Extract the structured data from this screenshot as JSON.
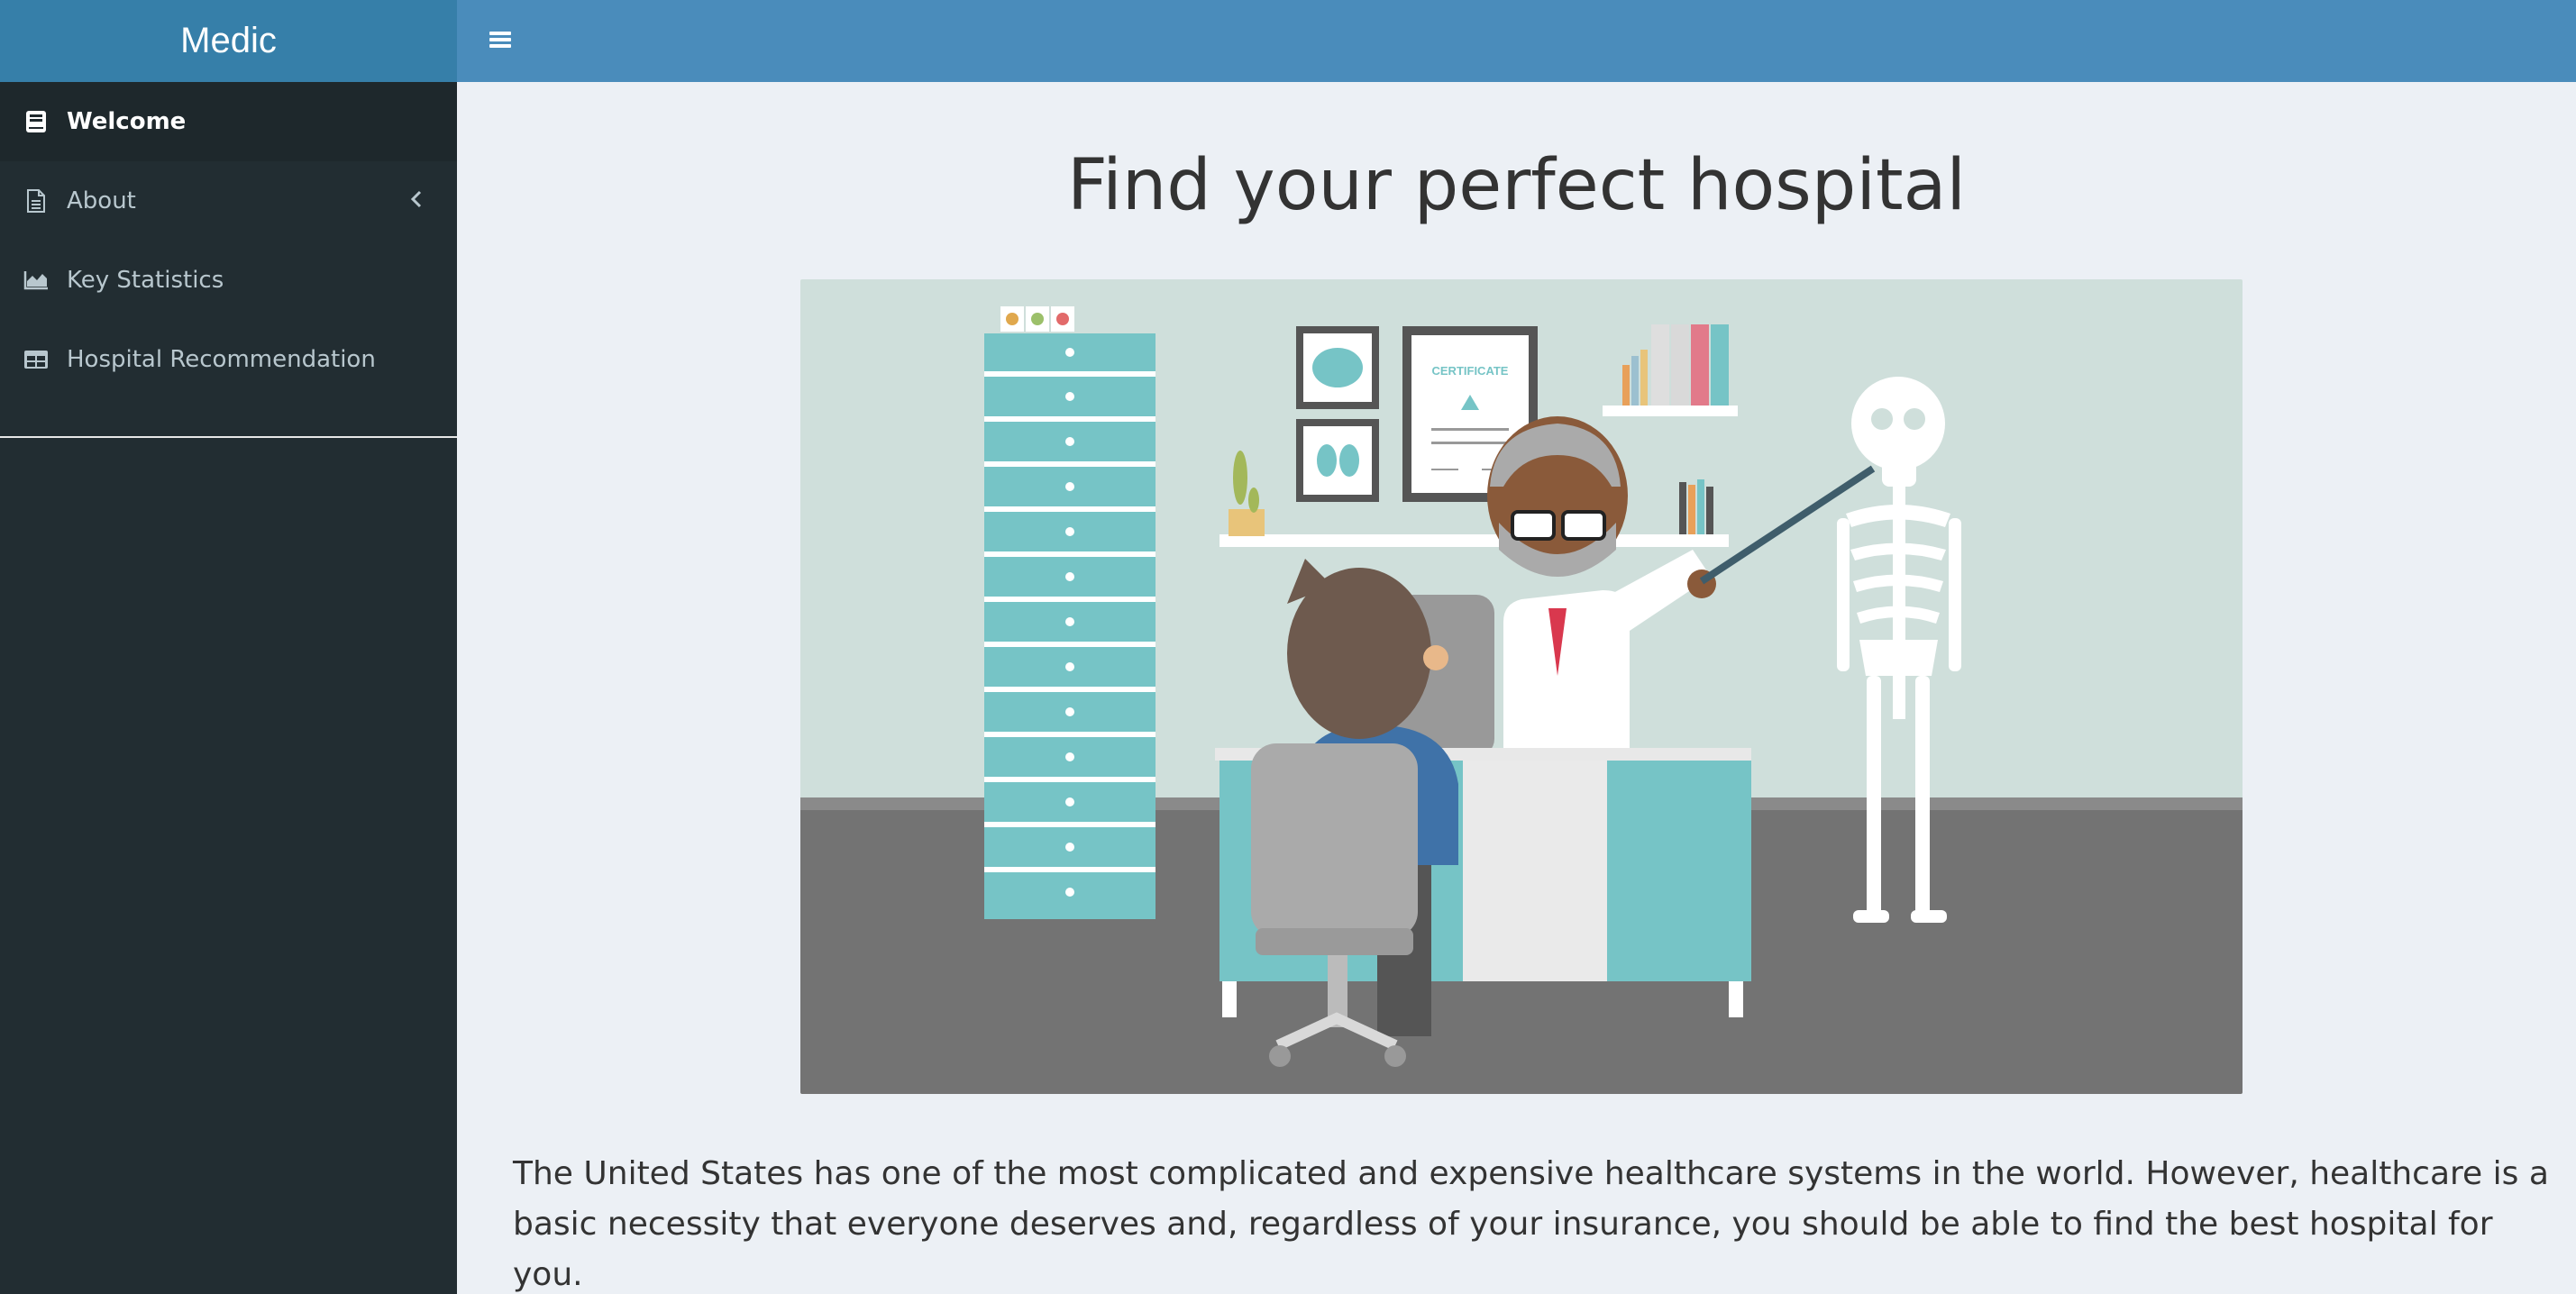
{
  "app": {
    "brand": "Medic"
  },
  "sidebar": {
    "items": [
      {
        "label": "Welcome",
        "icon": "book-icon",
        "active": true
      },
      {
        "label": "About",
        "icon": "file-icon",
        "active": false,
        "has_submenu": true
      },
      {
        "label": "Key Statistics",
        "icon": "area-chart-icon",
        "active": false
      },
      {
        "label": "Hospital Recommendation",
        "icon": "table-icon",
        "active": false
      }
    ]
  },
  "main": {
    "title": "Find your perfect hospital",
    "illustration": {
      "certificate_text": "CERTIFICATE"
    },
    "description": "The United States has one of the most complicated and expensive healthcare systems in the world. However, healthcare is a basic necessity that everyone deserves and, regardless of your insurance, you should be able to find the best hospital for you."
  },
  "colors": {
    "header": "#4a8cbb",
    "logo_bg": "#367fa9",
    "sidebar": "#222d32",
    "sidebar_active": "#1e282c",
    "content_bg": "#ecf0f5",
    "teal": "#76c4c6"
  }
}
